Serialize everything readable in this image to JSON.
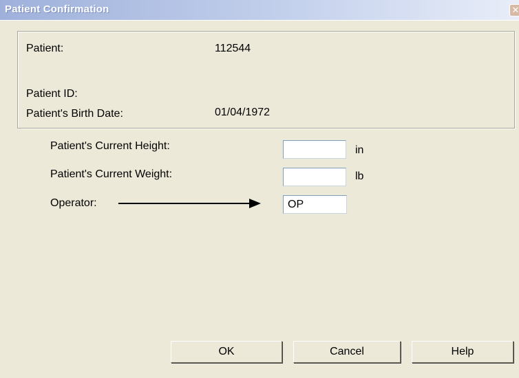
{
  "window": {
    "title": "Patient Confirmation",
    "close_glyph": "✕"
  },
  "patient_info": {
    "patient_label": "Patient:",
    "patient_value": "112544",
    "patient_id_label": "Patient ID:",
    "patient_id_value": "",
    "birth_date_label": "Patient's Birth Date:",
    "birth_date_value": "01/04/1972"
  },
  "form": {
    "height_label": "Patient's Current Height:",
    "height_value": "",
    "height_unit": "in",
    "weight_label": "Patient's Current Weight:",
    "weight_value": "",
    "weight_unit": "lb",
    "operator_label": "Operator:",
    "operator_value": "OP"
  },
  "buttons": {
    "ok": "OK",
    "cancel": "Cancel",
    "help": "Help"
  },
  "colors": {
    "dialog_background": "#ECE9D8",
    "titlebar_gradient_start": "#9FB1DB",
    "titlebar_gradient_end": "#E8EDF8",
    "input_border": "#7F9DB9"
  },
  "icons": {
    "close": "close-icon",
    "arrow": "right-arrow-icon"
  }
}
